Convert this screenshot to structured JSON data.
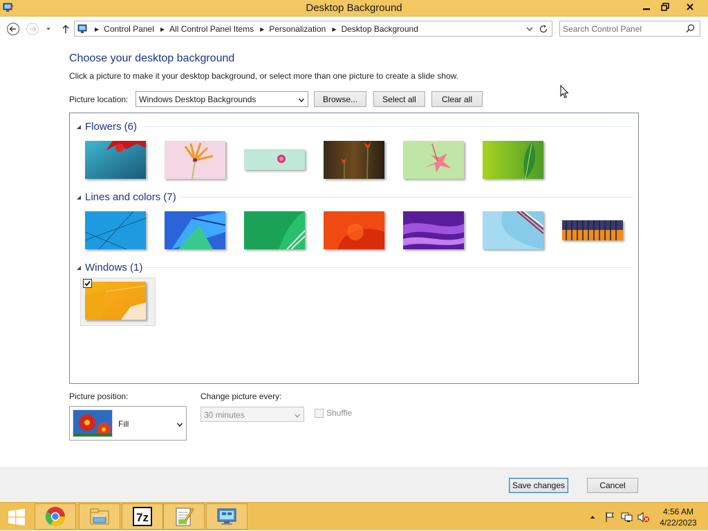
{
  "window": {
    "title": "Desktop Background",
    "minimize": "–",
    "maximize": "⧉",
    "close": "✕"
  },
  "addressbar": {
    "crumbs": [
      "Control Panel",
      "All Control Panel Items",
      "Personalization",
      "Desktop Background"
    ],
    "search_placeholder": "Search Control Panel"
  },
  "content": {
    "title": "Choose your desktop background",
    "description": "Click a picture to make it your desktop background, or select more than one picture to create a slide show.",
    "location_label": "Picture location:",
    "location_value": "Windows Desktop Backgrounds",
    "browse_label": "Browse...",
    "select_all_label": "Select all",
    "clear_all_label": "Clear all"
  },
  "gallery": {
    "groups": [
      {
        "name": "Flowers (6)"
      },
      {
        "name": "Lines and colors (7)"
      },
      {
        "name": "Windows (1)"
      }
    ],
    "selected_group": "Windows (1)",
    "selected_checked": true
  },
  "bottom": {
    "position_label": "Picture position:",
    "position_value": "Fill",
    "interval_label": "Change picture every:",
    "interval_value": "30 minutes",
    "shuffle_label": "Shuffle",
    "shuffle_checked": false
  },
  "footer": {
    "save_label": "Save changes",
    "cancel_label": "Cancel"
  },
  "taskbar": {
    "apps": [
      "chrome-icon",
      "file-explorer-icon",
      "7zip-icon",
      "notepad-plus-plus-icon",
      "control-panel-icon"
    ],
    "clock_time": "4:56 AM",
    "clock_date": "4/22/2023"
  },
  "colors": {
    "accent_title": "#1e3287",
    "titlebar": "#f3c862",
    "taskbar": "#f0c055"
  }
}
